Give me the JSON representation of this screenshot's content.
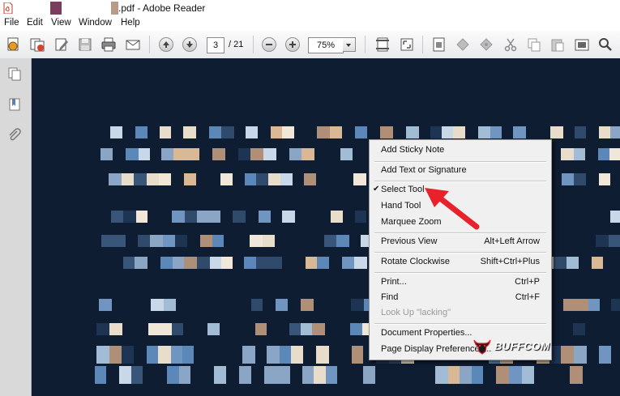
{
  "window": {
    "title": ".pdf - Adobe Reader",
    "pdf_icon": "pdf-file-icon"
  },
  "menubar": [
    "File",
    "Edit",
    "View",
    "Window",
    "Help"
  ],
  "toolbar": {
    "icons": [
      "create-pdf-icon",
      "combine-files-icon",
      "edit-icon",
      "save-icon",
      "print-icon",
      "email-icon",
      "previous-page-icon",
      "next-page-icon",
      "zoom-out-icon",
      "zoom-in-icon",
      "fit-page-icon",
      "full-screen-icon",
      "read-mode-icon",
      "tool-1-icon",
      "tool-2-icon",
      "cut-icon",
      "copy-icon",
      "paste-icon",
      "snapshot-icon",
      "find-icon"
    ],
    "current_page": "3",
    "page_total": "/ 21",
    "zoom": "75%"
  },
  "sidebar": {
    "icons": [
      "pages-icon",
      "bookmarks-icon",
      "attachments-icon"
    ]
  },
  "context_menu": {
    "items": [
      {
        "label": "Add Sticky Note"
      },
      {
        "label": "Add Text or Signature"
      },
      {
        "label": "Select Tool",
        "checked": true
      },
      {
        "label": "Hand Tool"
      },
      {
        "label": "Marquee Zoom"
      },
      {
        "label": "Previous View",
        "shortcut": "Alt+Left Arrow"
      },
      {
        "label": "Rotate Clockwise",
        "shortcut": "Shift+Ctrl+Plus"
      },
      {
        "label": "Print...",
        "shortcut": "Ctrl+P"
      },
      {
        "label": "Find",
        "shortcut": "Ctrl+F"
      },
      {
        "label": "Look Up \"lacking\"",
        "disabled": true
      },
      {
        "label": "Document Properties..."
      },
      {
        "label": "Page Display Preferences..."
      }
    ],
    "check_glyph": "✔"
  },
  "watermark": {
    "text": "BUFFCOM"
  },
  "colors": {
    "document_bg": "#0f1d33",
    "annotation_arrow": "#e8212a"
  }
}
